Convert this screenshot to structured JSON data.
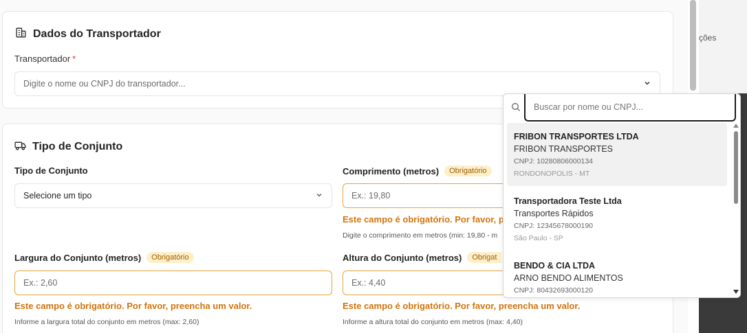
{
  "transportador_card": {
    "title": "Dados do Transportador",
    "icon": "building-icon",
    "field_label": "Transportador",
    "required_mark": "*",
    "placeholder": "Digite o nome ou CNPJ do transportador..."
  },
  "conjunto_card": {
    "title": "Tipo de Conjunto",
    "icon": "truck-icon",
    "tipo": {
      "label": "Tipo de Conjunto",
      "value": "Selecione um tipo"
    },
    "comprimento": {
      "label": "Comprimento (metros)",
      "badge": "Obrigatório",
      "placeholder": "Ex.: 19,80",
      "error": "Este campo é obrigatório. Por favor, pree",
      "help": "Digite o comprimento em metros (min: 19,80 - m"
    },
    "largura": {
      "label": "Largura do Conjunto (metros)",
      "badge": "Obrigatório",
      "placeholder": "Ex.: 2,60",
      "error": "Este campo é obrigatório. Por favor, preencha um valor.",
      "help": "Informe a largura total do conjunto em metros (max: 2,60)"
    },
    "altura": {
      "label": "Altura do Conjunto (metros)",
      "badge": "Obrigat",
      "placeholder": "Ex.: 4,40",
      "error": "Este campo é obrigatório. Por favor, preencha um valor.",
      "help": "Informe a altura total do conjunto em metros (max: 4,40)"
    }
  },
  "side_panel": {
    "text": "ções"
  },
  "dropdown": {
    "search_placeholder": "Buscar por nome ou CNPJ...",
    "items": [
      {
        "name": "FRIBON TRANSPORTES LTDA",
        "fantasy": "FRIBON TRANSPORTES",
        "cnpj": "CNPJ: 10280806000134",
        "city": "RONDONOPOLIS - MT"
      },
      {
        "name": "Transportadora Teste Ltda",
        "fantasy": "Transportes Rápidos",
        "cnpj": "CNPJ: 12345678000190",
        "city": "São Paulo - SP"
      },
      {
        "name": "BENDO & CIA LTDA",
        "fantasy": "ARNO BENDO ALIMENTOS",
        "cnpj": "CNPJ: 80432693000120",
        "city": ""
      }
    ]
  },
  "colors": {
    "error": "#d2740c",
    "badge_bg": "#fdf0c8",
    "error_border": "#e7a33a"
  }
}
